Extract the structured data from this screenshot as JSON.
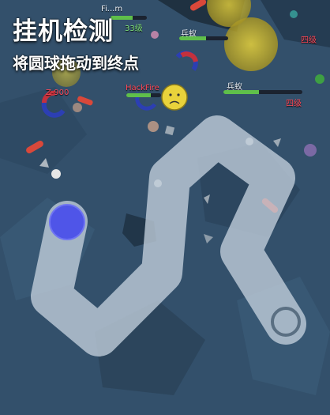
{
  "hud": {
    "title": "挂机检测",
    "subtitle": "将圆球拖动到终点"
  },
  "players": [
    {
      "name": "兵蚁",
      "level": "四级",
      "hp": 0.55
    },
    {
      "name": "兵蚁",
      "level": "四级",
      "hp": 0.45
    },
    {
      "name": "HackFire",
      "level": "",
      "hp": 0.7
    },
    {
      "name": "Z-900",
      "level": "",
      "hp": 0.6
    },
    {
      "name": "Fi...m",
      "level": "33级",
      "hp": 0.6
    }
  ],
  "colors": {
    "background": "#2f4a63",
    "path": "#c3cfdc",
    "ball": "#4f55e8",
    "goal_ring": "#5a6f82",
    "hud_text": "#ffffff"
  }
}
